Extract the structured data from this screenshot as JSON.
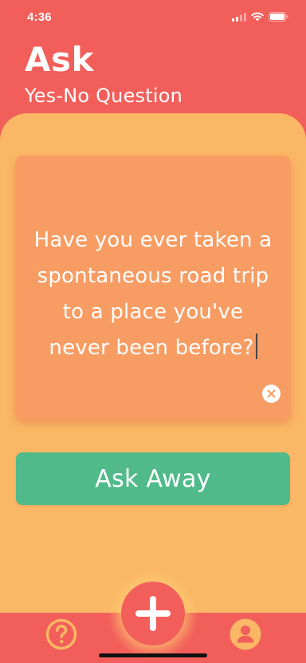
{
  "status_bar": {
    "time": "4:36",
    "icons": [
      "signal-icon",
      "wifi-icon",
      "battery-icon"
    ]
  },
  "header": {
    "title": "Ask",
    "subtitle": "Yes-No Question"
  },
  "question_card": {
    "text": "Have you ever taken a spontaneous road trip to a place you've never been before?",
    "clear_icon": "close-icon"
  },
  "ask_button": {
    "label": "Ask Away"
  },
  "tab_bar": {
    "left_icon": "question-mark-icon",
    "center_icon": "plus-icon",
    "right_icon": "user-icon"
  },
  "colors": {
    "header_bg": "#f25e5a",
    "panel_bg": "#fab765",
    "card_bg": "#f79c63",
    "button_bg": "#51ba8a",
    "tab_icon": "#fab765",
    "text": "#ffffff"
  }
}
